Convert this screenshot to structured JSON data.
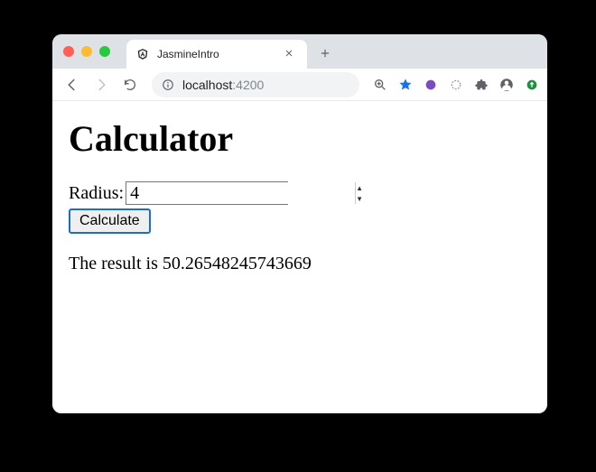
{
  "tab": {
    "title": "JasmineIntro"
  },
  "address": {
    "host": "localhost",
    "port": ":4200"
  },
  "page": {
    "heading": "Calculator",
    "radius_label": "Radius:",
    "radius_value": "4",
    "calculate_label": "Calculate",
    "result_prefix": "The result is ",
    "result_value": "50.26548245743669"
  },
  "icons": {
    "zoom": "zoom-icon",
    "star": "star-icon",
    "ext1": "extension-purple-icon",
    "ext2": "extension-circle-icon",
    "puzzle": "extensions-icon",
    "profile": "profile-icon",
    "update": "update-icon"
  }
}
